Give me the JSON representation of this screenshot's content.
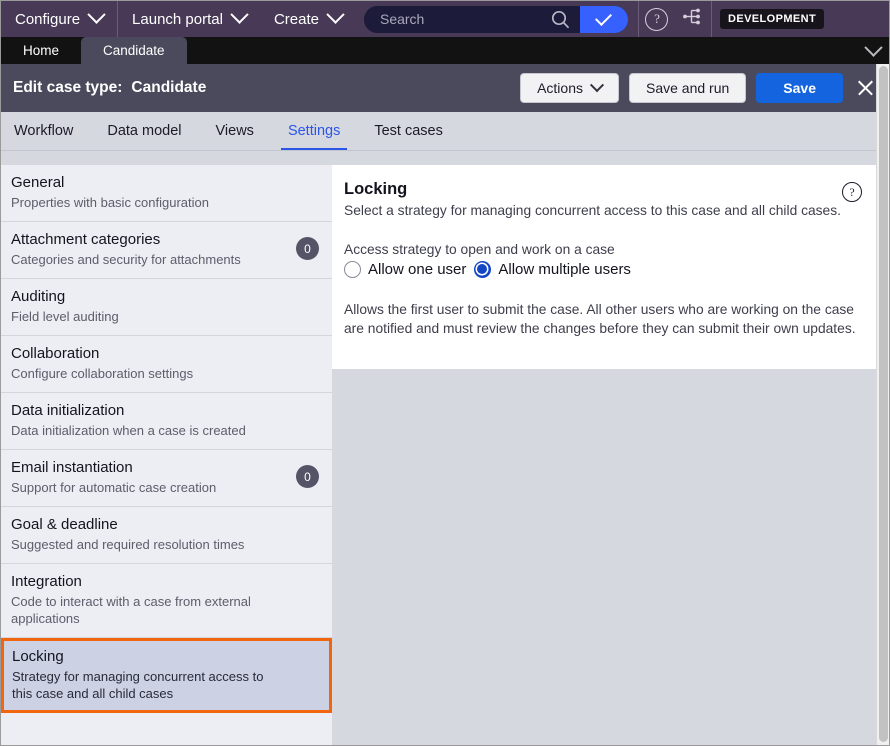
{
  "topnav": {
    "menus": [
      {
        "label": "Configure",
        "icon": "chevron-down-icon"
      },
      {
        "label": "Launch portal",
        "icon": "chevron-down-icon"
      },
      {
        "label": "Create",
        "icon": "chevron-down-icon"
      }
    ],
    "search": {
      "placeholder": "Search",
      "value": "",
      "search_icon": "magnifier-icon",
      "submit_icon": "checkmark-icon"
    },
    "help_icon": "question-circle-icon",
    "tree_icon": "branch-hierarchy-icon",
    "environment_badge": "DEVELOPMENT",
    "colors": {
      "bar": "#483a56",
      "search_submit": "#3761ff"
    }
  },
  "window_tabs": {
    "items": [
      {
        "label": "Home",
        "active": false
      },
      {
        "label": "Candidate",
        "active": true
      }
    ],
    "overflow_icon": "chevron-down-icon"
  },
  "edit_header": {
    "label": "Edit case type:",
    "value": "Candidate",
    "actions_button": "Actions",
    "actions_icon": "chevron-down-icon",
    "save_and_run_button": "Save and run",
    "save_button": "Save",
    "close_icon": "close-icon",
    "primary_color": "#1464e0"
  },
  "section_tabs": {
    "items": [
      {
        "label": "Workflow",
        "active": false
      },
      {
        "label": "Data model",
        "active": false
      },
      {
        "label": "Views",
        "active": false
      },
      {
        "label": "Settings",
        "active": true
      },
      {
        "label": "Test cases",
        "active": false
      }
    ],
    "active_color": "#2b56e8"
  },
  "sidebar": {
    "items": [
      {
        "title": "General",
        "desc": "Properties with basic configuration",
        "badge": null,
        "selected": false
      },
      {
        "title": "Attachment categories",
        "desc": "Categories and security for attachments",
        "badge": "0",
        "selected": false
      },
      {
        "title": "Auditing",
        "desc": "Field level auditing",
        "badge": null,
        "selected": false
      },
      {
        "title": "Collaboration",
        "desc": "Configure collaboration settings",
        "badge": null,
        "selected": false
      },
      {
        "title": "Data initialization",
        "desc": "Data initialization when a case is created",
        "badge": null,
        "selected": false
      },
      {
        "title": "Email instantiation",
        "desc": "Support for automatic case creation",
        "badge": "0",
        "selected": false
      },
      {
        "title": "Goal & deadline",
        "desc": "Suggested and required resolution times",
        "badge": null,
        "selected": false
      },
      {
        "title": "Integration",
        "desc": "Code to interact with a case from external applications",
        "badge": null,
        "selected": false
      },
      {
        "title": "Locking",
        "desc": "Strategy for managing concurrent access to this case and all child cases",
        "badge": null,
        "selected": true
      }
    ],
    "highlight_color": "#f2650f",
    "selected_bg": "#ccd1e4"
  },
  "content": {
    "title": "Locking",
    "subtitle": "Select a strategy for managing concurrent access to this case and all child cases.",
    "help_icon": "question-circle-icon",
    "field_label": "Access strategy to open and work on a case",
    "radio_options": [
      {
        "label": "Allow one user",
        "checked": false
      },
      {
        "label": "Allow multiple users",
        "checked": true
      }
    ],
    "help_text": "Allows the first user to submit the case. All other users who are working on the case are notified and must review the changes before they can submit their own updates.",
    "radio_color": "#1246c4"
  },
  "scrollbar": {
    "vertical_thumb": "page-scroll-thumb"
  }
}
